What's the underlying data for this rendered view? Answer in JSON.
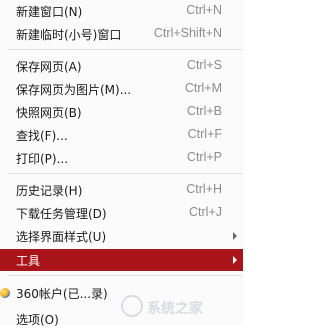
{
  "menu": {
    "items": [
      {
        "label": "新建窗口(N)",
        "shortcut": "Ctrl+N"
      },
      {
        "label": "新建临时(小号)窗口",
        "shortcut": "Ctrl+Shift+N"
      },
      {
        "label": "保存网页(A)",
        "shortcut": "Ctrl+S"
      },
      {
        "label": "保存网页为图片(M)...",
        "shortcut": "Ctrl+M"
      },
      {
        "label": "快照网页(B)",
        "shortcut": "Ctrl+B"
      },
      {
        "label": "查找(F)...",
        "shortcut": "Ctrl+F"
      },
      {
        "label": "打印(P)...",
        "shortcut": "Ctrl+P"
      },
      {
        "label": "历史记录(H)",
        "shortcut": "Ctrl+H"
      },
      {
        "label": "下载任务管理(D)",
        "shortcut": "Ctrl+J"
      },
      {
        "label": "选择界面样式(U)",
        "shortcut": ""
      },
      {
        "label": "工具",
        "shortcut": ""
      },
      {
        "label": "360帐户(已...录)",
        "shortcut": ""
      },
      {
        "label": "选项(O)",
        "shortcut": ""
      }
    ],
    "highlight_color": "#a8141a"
  },
  "watermark": {
    "text": "系统之家"
  }
}
